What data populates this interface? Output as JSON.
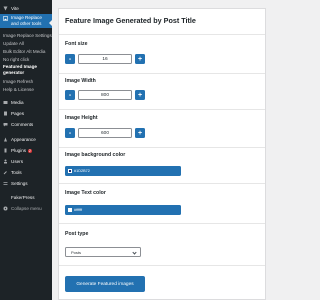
{
  "sidebar": {
    "top_label": "Vite",
    "active_plugin": "Image Replace\nand other tools",
    "sub_items": [
      "Image Replace Settings",
      "Update All",
      "Bulk Editor Alt Media",
      "No right click",
      "Featured Image generator",
      "Image Refresh",
      "Help & License"
    ],
    "menu": [
      {
        "label": "Media",
        "icon": "media-icon"
      },
      {
        "label": "Pages",
        "icon": "pages-icon"
      },
      {
        "label": "Comments",
        "icon": "comments-icon"
      },
      {
        "label": "Appearance",
        "icon": "appearance-icon"
      },
      {
        "label": "Plugins",
        "icon": "plugins-icon",
        "badge": "2"
      },
      {
        "label": "Users",
        "icon": "users-icon"
      },
      {
        "label": "Tools",
        "icon": "tools-icon"
      },
      {
        "label": "Settings",
        "icon": "settings-icon"
      },
      {
        "label": "FakerPress",
        "icon": ""
      },
      {
        "label": "Collapse menu",
        "icon": "collapse-icon"
      }
    ]
  },
  "form": {
    "title": "Feature Image Generated by Post Title",
    "font_size": {
      "label": "Font size",
      "value": "16"
    },
    "image_width": {
      "label": "Image Width",
      "value": "800"
    },
    "image_height": {
      "label": "Image Height",
      "value": "600"
    },
    "bg_color": {
      "label": "Image background color",
      "value": "#1D2B72"
    },
    "text_color": {
      "label": "Image Text color",
      "value": "#ffffff"
    },
    "post_type": {
      "label": "Post type",
      "value": "Posts"
    },
    "submit_label": "Generate Featured images",
    "minus": "-",
    "plus": "+"
  },
  "colors": {
    "sidebar_bg": "#1d2327",
    "accent": "#2271b1",
    "page_bg": "#f0f0f1"
  }
}
